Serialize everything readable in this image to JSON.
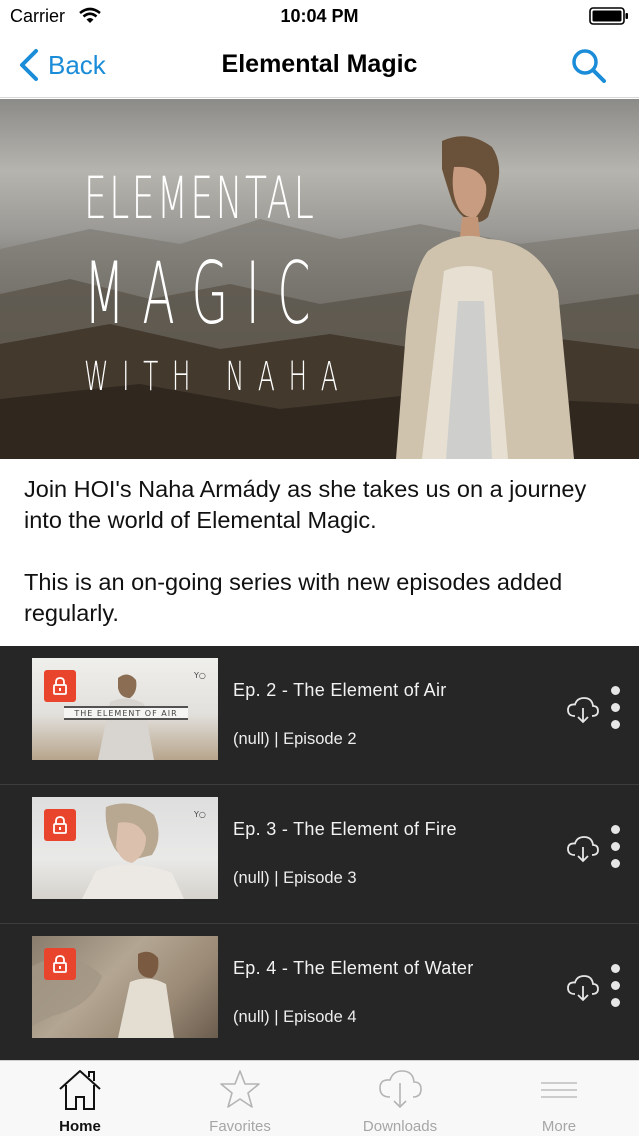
{
  "status_bar": {
    "carrier": "Carrier",
    "time": "10:04 PM"
  },
  "nav": {
    "back_label": "Back",
    "title": "Elemental Magic"
  },
  "hero": {
    "line1": "ELEMENTAL",
    "line2": "MAGIC",
    "line3": "WITH NAHA"
  },
  "description": {
    "paragraph1": "Join HOI's Naha Armády as she takes us on a journey into the world of Elemental Magic.",
    "paragraph2": "This is an on-going series with new episodes added regularly."
  },
  "episodes": [
    {
      "title": "Ep. 2 - The Element of Air",
      "subtitle": "(null) | Episode 2",
      "thumb_caption": "THE ELEMENT OF AIR",
      "locked": true
    },
    {
      "title": "Ep. 3 - The Element of Fire",
      "subtitle": "(null) | Episode 3",
      "locked": true
    },
    {
      "title": "Ep. 4 - The Element of Water",
      "subtitle": "(null) | Episode 4",
      "locked": true
    }
  ],
  "tabs": [
    {
      "label": "Home",
      "icon": "home-icon",
      "active": true
    },
    {
      "label": "Favorites",
      "icon": "star-icon",
      "active": false
    },
    {
      "label": "Downloads",
      "icon": "cloud-download-icon",
      "active": false
    },
    {
      "label": "More",
      "icon": "menu-icon",
      "active": false
    }
  ],
  "colors": {
    "accent": "#1a8cd8",
    "list_bg": "#262626",
    "lock": "#e8452c"
  }
}
